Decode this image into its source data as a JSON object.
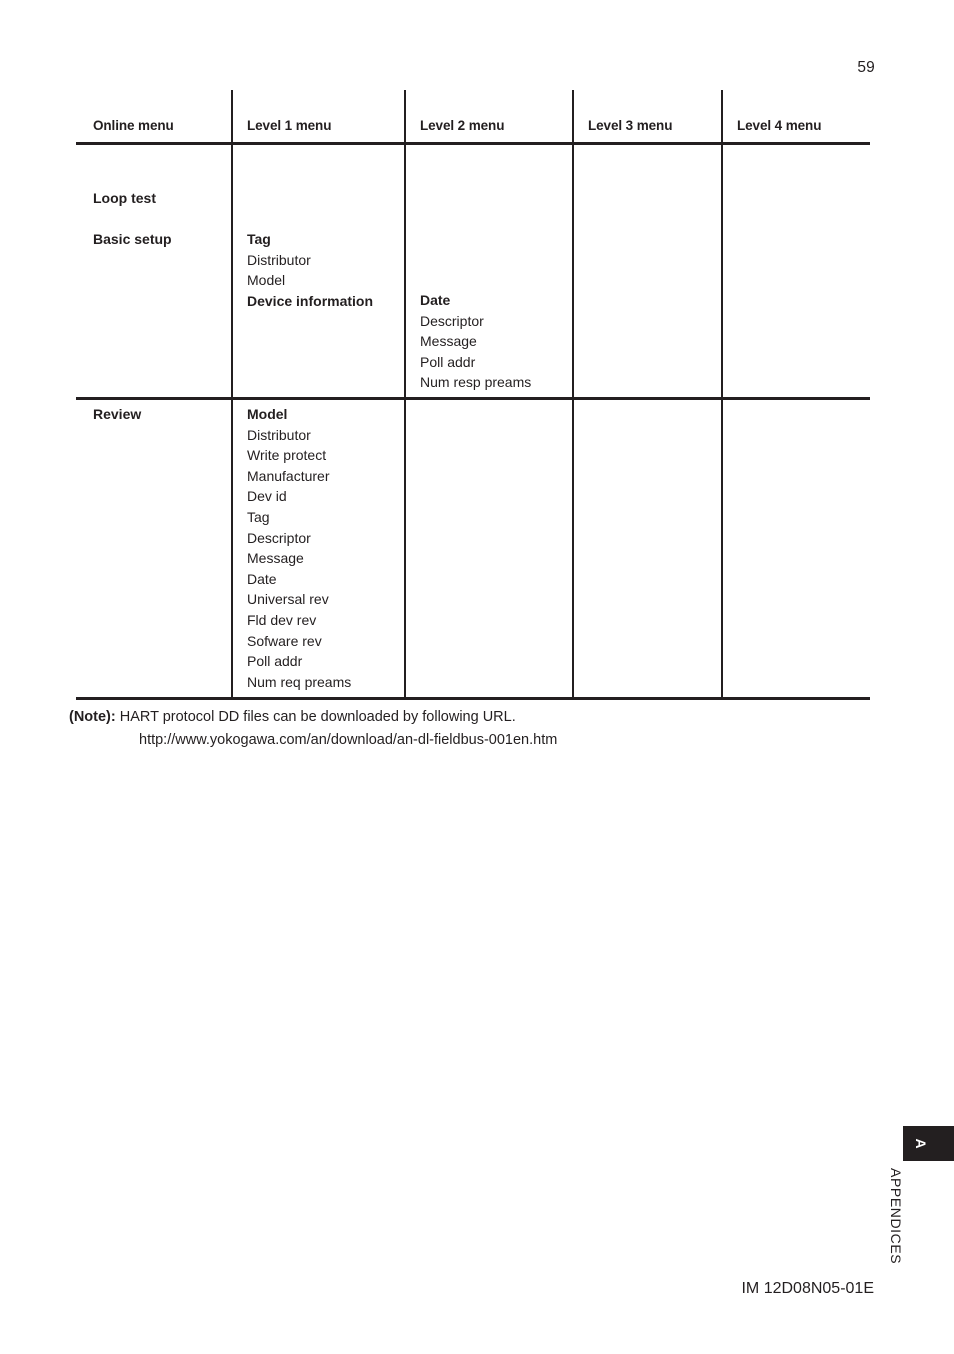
{
  "page": {
    "number": "59",
    "footer_code": "IM 12D08N05-01E"
  },
  "side_tab": {
    "letter": "A",
    "label": "APPENDICES"
  },
  "table": {
    "columns": [
      {
        "label": "Online menu"
      },
      {
        "label": "Level 1 menu"
      },
      {
        "label": "Level 2 menu"
      },
      {
        "label": "Level 3 menu"
      },
      {
        "label": "Level 4 menu"
      }
    ],
    "sections": [
      {
        "online_menu": [
          {
            "text": "Loop test",
            "bold": true
          },
          {
            "text": "",
            "bold": false
          },
          {
            "text": "Basic setup",
            "bold": true
          }
        ],
        "level1_menu": [
          {
            "text": "Tag",
            "bold": true
          },
          {
            "text": "Distributor",
            "bold": false
          },
          {
            "text": "Model",
            "bold": false
          },
          {
            "text": "Device information",
            "bold": true
          }
        ],
        "level2_menu": [
          {
            "text": "Date",
            "bold": true
          },
          {
            "text": "Descriptor",
            "bold": false
          },
          {
            "text": "Message",
            "bold": false
          },
          {
            "text": "Poll addr",
            "bold": false
          },
          {
            "text": "Num resp preams",
            "bold": false
          }
        ],
        "level3_menu": [],
        "level4_menu": []
      },
      {
        "online_menu": [
          {
            "text": "Review",
            "bold": true
          }
        ],
        "level1_menu": [
          {
            "text": "Model",
            "bold": true
          },
          {
            "text": "Distributor",
            "bold": false
          },
          {
            "text": "Write protect",
            "bold": false
          },
          {
            "text": "Manufacturer",
            "bold": false
          },
          {
            "text": "Dev id",
            "bold": false
          },
          {
            "text": "Tag",
            "bold": false
          },
          {
            "text": "Descriptor",
            "bold": false
          },
          {
            "text": "Message",
            "bold": false
          },
          {
            "text": "Date",
            "bold": false
          },
          {
            "text": "Universal rev",
            "bold": false
          },
          {
            "text": "Fld dev rev",
            "bold": false
          },
          {
            "text": "Sofware rev",
            "bold": false
          },
          {
            "text": "Poll addr",
            "bold": false
          },
          {
            "text": "Num req preams",
            "bold": false
          }
        ],
        "level2_menu": [],
        "level3_menu": [],
        "level4_menu": []
      }
    ]
  },
  "note": {
    "label": "(Note):",
    "text": "HART protocol DD files can be downloaded by following URL.",
    "url": "http://www.yokogawa.com/an/download/an-dl-fieldbus-001en.htm"
  }
}
